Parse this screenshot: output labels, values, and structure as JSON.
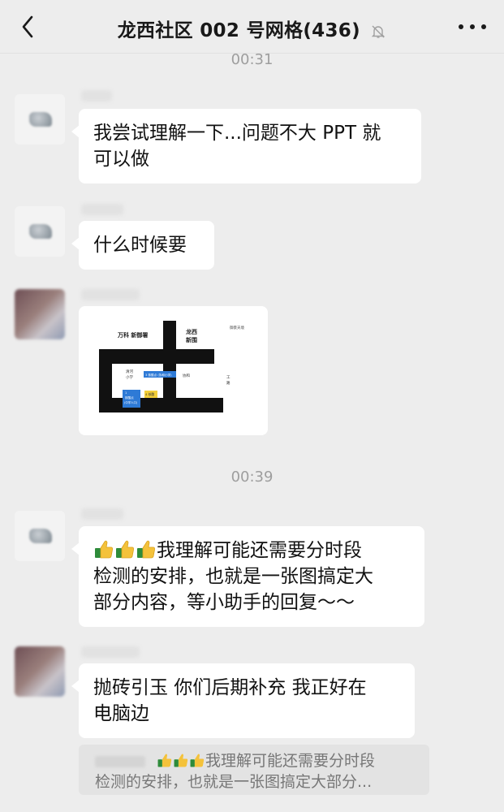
{
  "header": {
    "title": "龙西社区 002 号网格(436)",
    "back_icon": "chevron-left-icon",
    "mute_icon": "bell-off-icon",
    "more_icon": "more-dots-icon"
  },
  "messages": {
    "ts1": "00:31",
    "m1_line1": "我尝试理解一下...问题不大 PPT 就",
    "m1_line2": "可以做",
    "m2_line1": "什么时候要",
    "map": {
      "label_wanke": "万科 新御署",
      "label_longxi": "龙西",
      "label_xinwei": "新围",
      "label_top_right": "御景天境",
      "label_school": "清河",
      "label_school2": "小学",
      "label_mid": "协和",
      "label_right": "工",
      "label_right2": "路",
      "label_blue1": "3 核酸点  (协和小学)",
      "label_blue2": "1",
      "label_blue3": "核酸点",
      "label_blue4": "(中学人口)",
      "label_yellow": "4 核酸"
    },
    "ts2": "00:39",
    "m3_line1": "我理解可能还需要分时段",
    "m3_line2": "检测的安排，也就是一张图搞定大",
    "m3_line3": "部分内容，等小助手的回复～～",
    "m4_line1": "抛砖引玉 你们后期补充 我正好在",
    "m4_line2": "电脑边",
    "quote_line1": "我理解可能还需要分时段",
    "quote_line2": "检测的安排，也就是一张图搞定大部分..."
  }
}
